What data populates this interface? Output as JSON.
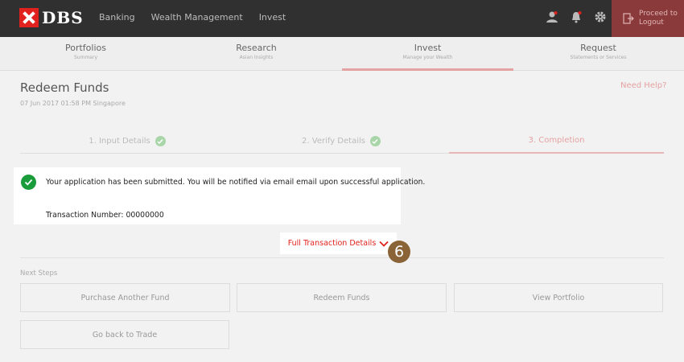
{
  "header": {
    "brand": "DBS",
    "nav": [
      "Banking",
      "Wealth Management",
      "Invest"
    ],
    "logout_line1": "Proceed to",
    "logout_line2": "Logout"
  },
  "subnav": [
    {
      "title": "Portfolios",
      "subtitle": "Summary"
    },
    {
      "title": "Research",
      "subtitle": "Asian Insights"
    },
    {
      "title": "Invest",
      "subtitle": "Manage your Wealth"
    },
    {
      "title": "Request",
      "subtitle": "Statements or Services"
    }
  ],
  "page": {
    "title": "Redeem Funds",
    "date": "07 Jun 2017 01:58 PM Singapore",
    "help": "Need Help?"
  },
  "steps": [
    "1. Input Details",
    "2. Verify Details",
    "3. Completion"
  ],
  "notice": {
    "message": "Your application has been submitted. You will be notified via email email upon successful application.",
    "txn_label": "Transaction Number:",
    "txn_number": "00000000"
  },
  "details_link": "Full Transaction Details",
  "callout_number": "6",
  "next_steps": {
    "heading": "Next Steps",
    "buttons": [
      "Purchase Another Fund",
      "Redeem Funds",
      "View Portfolio",
      "Go back to Trade"
    ]
  },
  "colors": {
    "brand": "#e0211d",
    "success": "#1a9c3a",
    "callout": "#8a6437"
  }
}
